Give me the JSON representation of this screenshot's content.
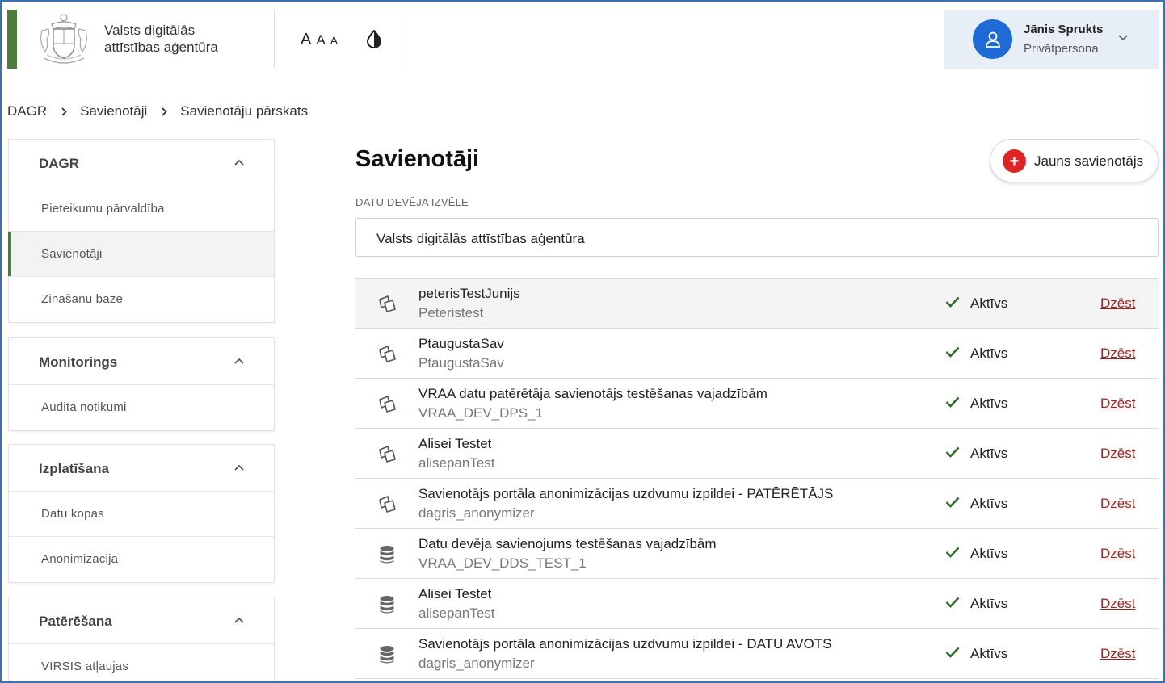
{
  "header": {
    "org_line1": "Valsts digitālās",
    "org_line2": "attīstības aģentūra",
    "font_size_labels": [
      "A",
      "A",
      "A"
    ],
    "user_name": "Jānis Sprukts",
    "user_role": "Privātpersona"
  },
  "breadcrumb": [
    "DAGR",
    "Savienotāji",
    "Savienotāju pārskats"
  ],
  "sidebar": [
    {
      "title": "DAGR",
      "items": [
        "Pieteikumu pārvaldība",
        "Savienotāji",
        "Zināšanu bāze"
      ],
      "active": "Savienotāji"
    },
    {
      "title": "Monitorings",
      "items": [
        "Audita notikumi"
      ]
    },
    {
      "title": "Izplatīšana",
      "items": [
        "Datu kopas",
        "Anonimizācija"
      ]
    },
    {
      "title": "Patērēšana",
      "items": [
        "VIRSIS atļaujas"
      ]
    }
  ],
  "main": {
    "title": "Savienotāji",
    "new_button": "Jauns savienotājs",
    "select_label": "DATU DEVĒJA IZVĒLE",
    "select_value": "Valsts digitālās attīstības aģentūra"
  },
  "connectors": [
    {
      "name": "peterisTestJunijs",
      "code": "Peteristest",
      "icon": "connector-icon",
      "status": "Aktīvs",
      "action": "Dzēst"
    },
    {
      "name": "PtaugustaSav",
      "code": "PtaugustaSav",
      "icon": "connector-icon",
      "status": "Aktīvs",
      "action": "Dzēst"
    },
    {
      "name": "VRAA datu patērētāja savienotājs testēšanas vajadzībām",
      "code": "VRAA_DEV_DPS_1",
      "icon": "connector-icon",
      "status": "Aktīvs",
      "action": "Dzēst"
    },
    {
      "name": "Alisei Testet",
      "code": "alisepanTest",
      "icon": "connector-icon",
      "status": "Aktīvs",
      "action": "Dzēst"
    },
    {
      "name": "Savienotājs portāla anonimizācijas uzdvumu izpildei - PATĒRĒTĀJS",
      "code": "dagris_anonymizer",
      "icon": "connector-icon",
      "status": "Aktīvs",
      "action": "Dzēst"
    },
    {
      "name": "Datu devēja savienojums testēšanas vajadzībām",
      "code": "VRAA_DEV_DDS_TEST_1",
      "icon": "database-icon",
      "status": "Aktīvs",
      "action": "Dzēst"
    },
    {
      "name": "Alisei Testet",
      "code": "alisepanTest",
      "icon": "database-icon",
      "status": "Aktīvs",
      "action": "Dzēst"
    },
    {
      "name": "Savienotājs portāla anonimizācijas uzdvumu izpildei - DATU AVOTS",
      "code": "dagris_anonymizer",
      "icon": "database-icon",
      "status": "Aktīvs",
      "action": "Dzēst"
    }
  ],
  "colors": {
    "brand_green": "#4e7a3d",
    "accent_blue": "#1e6bd6",
    "add_red": "#e02424",
    "delete_red": "#a01f1f",
    "check_green": "#2f6b2a"
  }
}
